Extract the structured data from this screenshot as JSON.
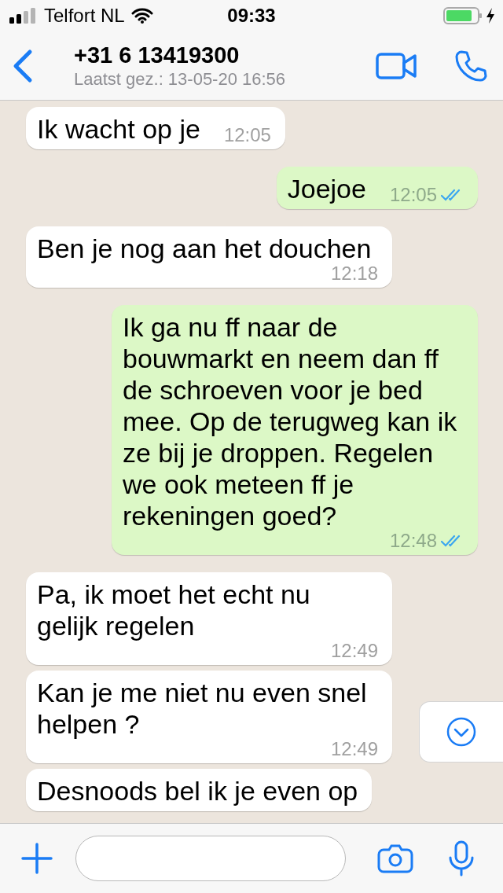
{
  "status_bar": {
    "carrier": "Telfort NL",
    "time": "09:33"
  },
  "header": {
    "contact": "+31 6 13419300",
    "last_seen": "Laatst gez.: 13-05-20 16:56"
  },
  "messages": [
    {
      "kind": "incoming",
      "text": "Ik wacht op je",
      "time": "12:05"
    },
    {
      "kind": "outgoing",
      "text": "Joejoe",
      "time": "12:05",
      "read": true
    },
    {
      "kind": "incoming",
      "text": "Ben je nog aan het douchen",
      "time": "12:18"
    },
    {
      "kind": "outgoing",
      "text": "Ik ga nu ff naar de bouwmarkt en neem dan ff de schroeven voor je bed mee. Op de terugweg kan ik ze bij je droppen. Regelen we ook meteen ff je rekeningen goed?",
      "time": "12:48",
      "read": true
    },
    {
      "kind": "incoming",
      "text": "Pa, ik moet het echt nu gelijk regelen",
      "time": "12:49"
    },
    {
      "kind": "incoming",
      "text": "Kan je me niet nu even snel helpen ?",
      "time": "12:49"
    },
    {
      "kind": "incoming",
      "text": "Desnoods bel ik je even op"
    }
  ]
}
